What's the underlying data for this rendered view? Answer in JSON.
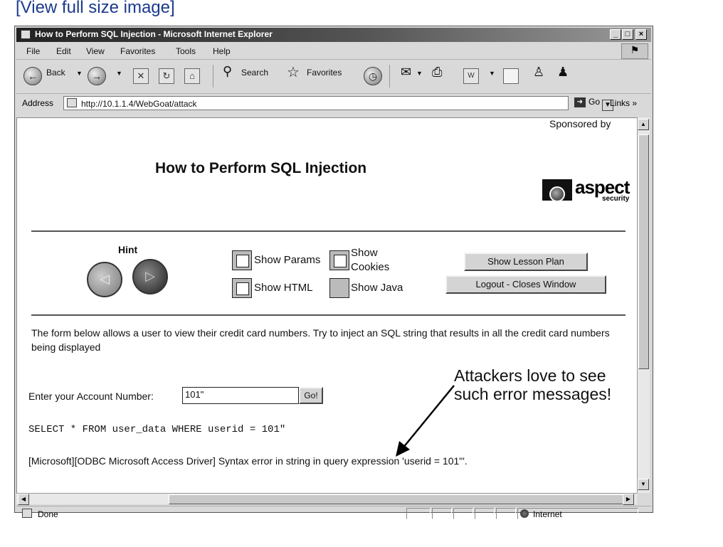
{
  "view_link": "[View full size image]",
  "window": {
    "title": "How to Perform SQL Injection - Microsoft Internet Explorer",
    "controls": [
      "_",
      "□",
      "×"
    ]
  },
  "menu": [
    "File",
    "Edit",
    "View",
    "Favorites",
    "Tools",
    "Help"
  ],
  "toolbar": {
    "back": "Back",
    "search": "Search",
    "favorites": "Favorites"
  },
  "address": {
    "label": "Address",
    "url": "http://10.1.1.4/WebGoat/attack",
    "go": "Go",
    "links": "Links »"
  },
  "page": {
    "sponsored": "Sponsored by",
    "title": "How to Perform SQL Injection",
    "logo_name": "aspect",
    "logo_sub": "security",
    "hint": "Hint",
    "show_params": "Show Params",
    "show_cookies": "Show Cookies",
    "show_html": "Show HTML",
    "show_java": "Show Java",
    "show_lesson_plan": "Show Lesson Plan",
    "logout": "Logout - Closes Window",
    "intro": "The form below allows a user to view their credit card numbers. Try to inject an SQL string that results in all the credit card numbers being displayed",
    "account_label": "Enter your Account Number:",
    "account_value": "101\"",
    "go_button": "Go!",
    "sql": "SELECT * FROM user_data WHERE userid = 101\"",
    "error": "[Microsoft][ODBC Microsoft Access Driver] Syntax error in string in query expression 'userid = 101\"'.",
    "callout_line1": "Attackers love to see",
    "callout_line2": "such error messages!"
  },
  "status": {
    "text": "Done",
    "zone": "Internet"
  }
}
